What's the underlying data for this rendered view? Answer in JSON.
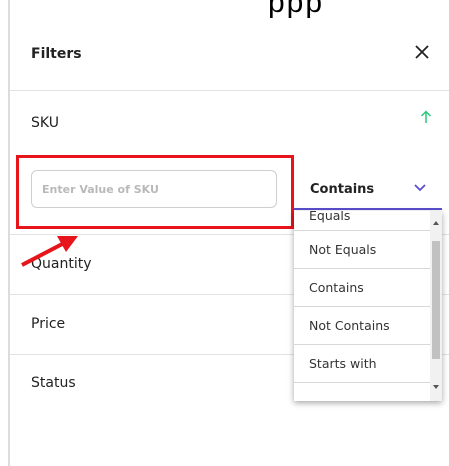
{
  "top_glyphs": "ppp",
  "panel": {
    "title": "Filters",
    "close_icon": "close-icon"
  },
  "sku": {
    "label": "SKU",
    "sort_icon": "arrow-up-icon",
    "input_placeholder": "Enter Value of SKU",
    "input_value": "",
    "operator": "Contains"
  },
  "fields": [
    {
      "label": "Quantity"
    },
    {
      "label": "Price"
    },
    {
      "label": "Status"
    }
  ],
  "operator_options": [
    "Equals",
    "Not Equals",
    "Contains",
    "Not Contains",
    "Starts with"
  ],
  "colors": {
    "accent": "#5a4fcf",
    "sort_arrow": "#2ec77c",
    "highlight": "#e8141b"
  }
}
